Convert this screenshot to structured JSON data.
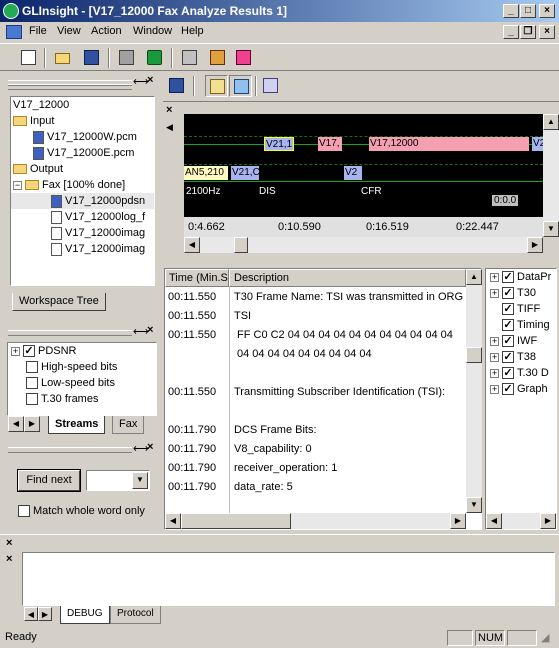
{
  "window": {
    "title": "GLInsight - [V17_12000 Fax Analyze Results 1]"
  },
  "menu": [
    "File",
    "View",
    "Action",
    "Window",
    "Help"
  ],
  "workspace_tree": {
    "root": "V17_12000",
    "input_folder": "Input",
    "input_files": [
      "V17_12000W.pcm",
      "V17_12000E.pcm"
    ],
    "output_folder": "Output",
    "fax_folder": "Fax [100% done]",
    "fax_files": [
      "V17_12000pdsn",
      "V17_12000log_f",
      "V17_12000imag",
      "V17_12000imag"
    ],
    "tab_label": "Workspace Tree"
  },
  "streams": {
    "items": [
      {
        "label": "PDSNR",
        "checked": true
      },
      {
        "label": "High-speed bits",
        "checked": false
      },
      {
        "label": "Low-speed bits",
        "checked": false
      },
      {
        "label": "T.30 frames",
        "checked": false
      }
    ],
    "tabs": [
      "Streams",
      "Fax"
    ]
  },
  "find": {
    "button_label": "Find next",
    "match_whole_word_label": "Match whole word only",
    "value": ""
  },
  "graph": {
    "segments_row1": [
      "V21,1",
      "V17,",
      "V17,12000",
      "V2"
    ],
    "segments_row2": [
      "AN5,210",
      "V21,C",
      "V2"
    ],
    "labels": [
      "2100Hz",
      "DIS",
      "CFR"
    ],
    "time_readout": "0:0.0",
    "ruler": [
      "0:4.662",
      "0:10.590",
      "0:16.519",
      "0:22.447"
    ]
  },
  "log_table": {
    "headers": [
      "Time (Min.Se",
      "Description"
    ],
    "rows": [
      {
        "time": "00:11.550",
        "desc": "T30 Frame Name: TSI was transmitted in ORG -"
      },
      {
        "time": "00:11.550",
        "desc": "TSI"
      },
      {
        "time": "00:11.550",
        "desc": "FF C0  C2 04  04 04  04 04  04 04  04 04  04 04"
      },
      {
        "time": "",
        "desc": "04 04  04 04  04 04  04 04  04"
      },
      {
        "time": "",
        "desc": ""
      },
      {
        "time": "00:11.550",
        "desc": "Transmitting Subscriber Identification (TSI):"
      },
      {
        "time": "",
        "desc": ""
      },
      {
        "time": "00:11.790",
        "desc": "DCS Frame Bits:"
      },
      {
        "time": "00:11.790",
        "desc": "V8_capability: 0"
      },
      {
        "time": "00:11.790",
        "desc": "receiver_operation: 1"
      },
      {
        "time": "00:11.790",
        "desc": "data_rate: 5"
      }
    ]
  },
  "right_tree": {
    "items": [
      {
        "label": "DataPr",
        "expander": true,
        "checked": true
      },
      {
        "label": "T30",
        "expander": true,
        "checked": true
      },
      {
        "label": "TIFF",
        "expander": false,
        "checked": true
      },
      {
        "label": "Timing",
        "expander": false,
        "checked": true
      },
      {
        "label": "IWF",
        "expander": true,
        "checked": true
      },
      {
        "label": "T38",
        "expander": true,
        "checked": true
      },
      {
        "label": "T.30 D",
        "expander": true,
        "checked": true
      },
      {
        "label": "Graph",
        "expander": true,
        "checked": true
      }
    ]
  },
  "bottom_tabs": [
    "DEBUG",
    "Protocol"
  ],
  "status": {
    "text": "Ready",
    "num": "NUM"
  },
  "colors": {
    "title_start": "#0a246a",
    "graph_bg": "#000000",
    "grid": "#1b6b1b",
    "seg_blue": "#a8b4f0",
    "seg_pink": "#f4a0b0",
    "seg_yellow": "#fff8c0"
  }
}
